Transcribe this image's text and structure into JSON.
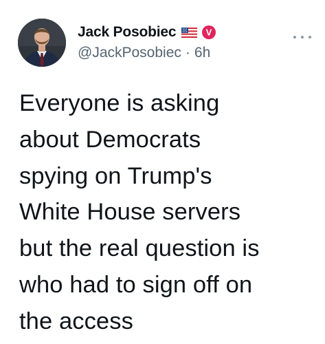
{
  "tweet": {
    "author": {
      "display_name": "Jack Posobiec",
      "flag_emoji": "us-flag-icon",
      "badge": "verified-icon",
      "badge_letter": "V",
      "badge_color": "#e0245e",
      "handle": "@JackPosobiec",
      "separator": "·",
      "time": "6h"
    },
    "more_label": "...",
    "text_lines": [
      "Everyone is asking",
      "about Democrats",
      "spying on Trump's",
      "White House servers",
      "but the real question is",
      "who had to sign off on",
      "the access"
    ]
  }
}
